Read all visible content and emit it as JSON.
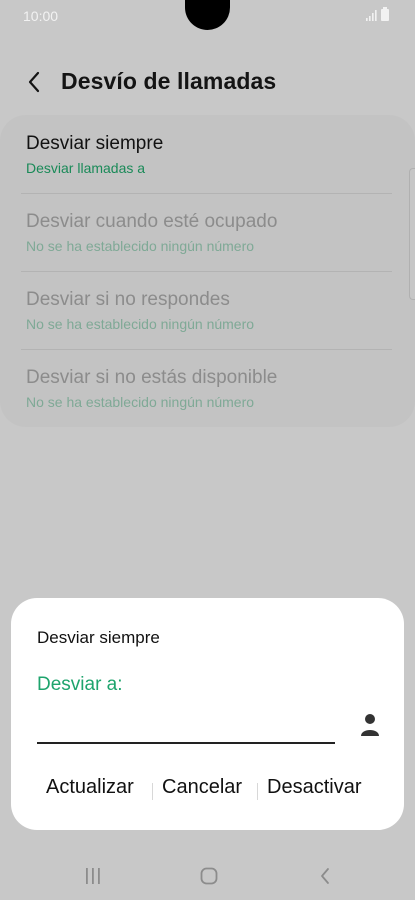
{
  "status_bar": {
    "time": "10:00",
    "icons": [
      "signal-icon",
      "battery-icon"
    ]
  },
  "header": {
    "back_icon": "chevron-left-icon",
    "title": "Desvío de llamadas"
  },
  "settings": {
    "items": [
      {
        "title": "Desviar siempre",
        "subtitle": "Desviar llamadas a",
        "enabled": true
      },
      {
        "title": "Desviar cuando esté ocupado",
        "subtitle": "No se ha establecido ningún número",
        "enabled": false
      },
      {
        "title": "Desviar si no respondes",
        "subtitle": "No se ha establecido ningún número",
        "enabled": false
      },
      {
        "title": "Desviar si no estás disponible",
        "subtitle": "No se ha establecido ningún número",
        "enabled": false
      }
    ]
  },
  "dialog": {
    "title": "Desviar siempre",
    "field_label": "Desviar a:",
    "field_value": "",
    "contact_icon": "person-icon",
    "actions": {
      "update": "Actualizar",
      "cancel": "Cancelar",
      "deactivate": "Desactivar"
    }
  },
  "nav_bar": {
    "icons": [
      "recent-apps-icon",
      "home-icon",
      "back-icon"
    ]
  },
  "colors": {
    "accent": "#1ea46d",
    "scrim_background": "#c8c8c8",
    "dialog_background": "#ffffff"
  }
}
